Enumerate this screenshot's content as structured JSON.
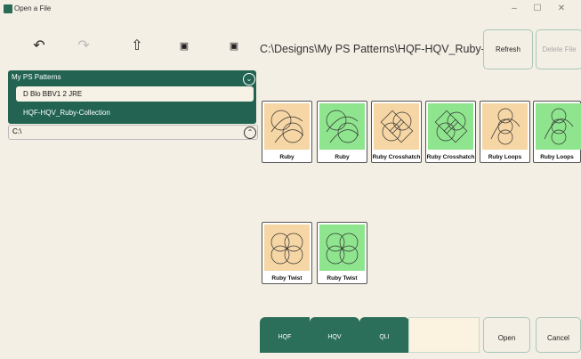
{
  "window": {
    "title": "Open a File",
    "minimize": "–",
    "maximize": "☐",
    "close": "✕"
  },
  "toolbar": {
    "undo_icon": "↶",
    "redo_icon": "↷",
    "up_icon": "⇧",
    "folder_icon": "▣",
    "folder_alt_icon": "▣",
    "path": "C:\\Designs\\My PS Patterns\\HQF-HQV_Ruby-Collection",
    "refresh_label": "Refresh",
    "delete_label": "Delete File"
  },
  "folders": {
    "header": "My PS Patterns",
    "expand_icon": "⌄",
    "items": [
      {
        "label": "D Blo BBV1 2 JRE"
      },
      {
        "label": "HQF-HQV_Ruby-Collection"
      }
    ],
    "drive": "C:\\",
    "drive_icon": "⌃"
  },
  "tiles": [
    {
      "label": "Ruby",
      "bg": "tan"
    },
    {
      "label": "Ruby",
      "bg": "green"
    },
    {
      "label": "Ruby Crosshatch",
      "bg": "tan"
    },
    {
      "label": "Ruby Crosshatch",
      "bg": "green"
    },
    {
      "label": "Ruby Loops",
      "bg": "tan"
    },
    {
      "label": "Ruby Loops",
      "bg": "green"
    },
    {
      "label": "Ruby Twist",
      "bg": "tan"
    },
    {
      "label": "Ruby Twist",
      "bg": "green"
    }
  ],
  "filters": [
    {
      "label": "HQF"
    },
    {
      "label": "HQV"
    },
    {
      "label": "QLI"
    }
  ],
  "actions": {
    "open": "Open",
    "cancel": "Cancel"
  },
  "colors": {
    "accent": "#226451",
    "tan": "#f6d6a4",
    "green": "#8fe48e",
    "background": "#f4efe4"
  }
}
